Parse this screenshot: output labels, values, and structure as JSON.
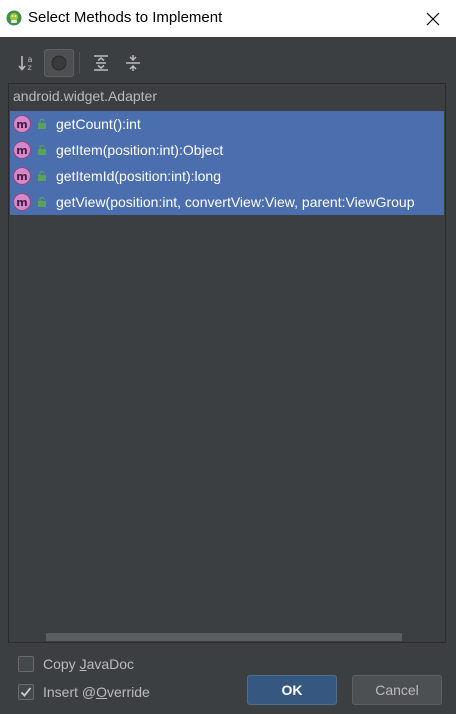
{
  "window": {
    "title": "Select Methods to Implement",
    "close_glyph": "✕"
  },
  "toolbar": {
    "buttons": [
      {
        "icon": "sort-alphabetically-icon"
      },
      {
        "icon": "show-classes-icon",
        "toggled": true
      },
      {
        "icon": "expand-all-icon"
      },
      {
        "icon": "collapse-all-icon"
      }
    ]
  },
  "tree": {
    "group": "android.widget.Adapter",
    "methods": [
      {
        "icon": "method-icon",
        "access": "public-lock-icon",
        "signature": "getCount():int"
      },
      {
        "icon": "method-icon",
        "access": "public-lock-icon",
        "signature": "getItem(position:int):Object"
      },
      {
        "icon": "method-icon",
        "access": "public-lock-icon",
        "signature": "getItemId(position:int):long"
      },
      {
        "icon": "method-icon",
        "access": "public-lock-icon",
        "signature": "getView(position:int, convertView:View, parent:ViewGroup"
      }
    ],
    "method_icon_letter": "m"
  },
  "options": {
    "copy_javadoc": {
      "label_pre": "Copy ",
      "label_mnemonic": "J",
      "label_post": "avaDoc",
      "checked": false
    },
    "insert_override": {
      "label_pre": "Insert @",
      "label_mnemonic": "O",
      "label_post": "verride",
      "checked": true
    }
  },
  "buttons": {
    "ok": "OK",
    "cancel": "Cancel"
  },
  "colors": {
    "background": "#3c3f41",
    "selection": "#4b6eaf",
    "ok_button": "#365880",
    "method_icon": "#d488c8",
    "access_icon": "#5aa25a"
  }
}
